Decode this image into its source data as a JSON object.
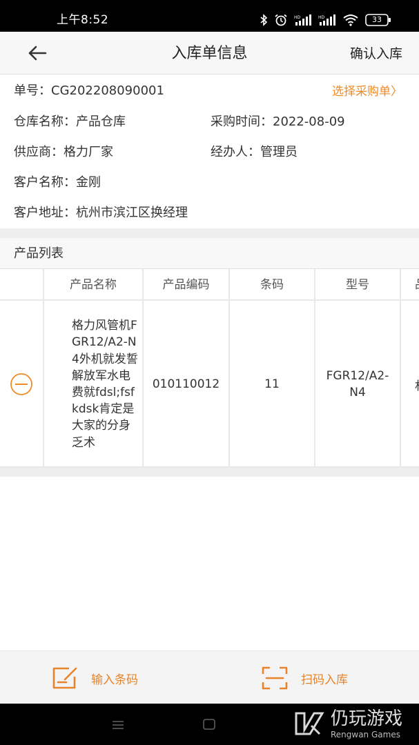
{
  "status_bar": {
    "time": "上午8:52",
    "battery": "33",
    "icons": [
      "bluetooth-icon",
      "alarm-icon",
      "signal-icon",
      "signal-icon",
      "wifi-icon",
      "battery-icon"
    ]
  },
  "header": {
    "title": "入库单信息",
    "confirm_label": "确认入库",
    "back_icon": "arrow-left-icon"
  },
  "order": {
    "number": "单号：CG202208090001",
    "select_po_label": "选择采购单〉",
    "warehouse": "仓库名称：产品仓库",
    "purchase_time": "采购时间：2022-08-09",
    "supplier": "供应商：格力厂家",
    "handler": "经办人：管理员",
    "customer_name": "客户名称：金刚",
    "customer_address": "客户地址：杭州市滨江区换经理"
  },
  "product_list": {
    "title": "产品列表",
    "columns": [
      "",
      "产品名称",
      "产品编码",
      "条码",
      "型号",
      "品"
    ],
    "rows": [
      {
        "name": "格力风管机FGR12/A2-N4外机就发誓解放军水电费就fdsl;fsfkdsk肯定是大家的分身乏术",
        "code": "010110012",
        "barcode": "11",
        "model": "FGR12/A2-N4",
        "extra": "村"
      }
    ]
  },
  "actions": {
    "input_barcode": "输入条码",
    "scan_in": "扫码入库"
  },
  "watermark": {
    "main": "仍玩游戏",
    "sub": "Rengwan Games"
  },
  "colors": {
    "accent": "#f08a24",
    "status_bar": "#000000",
    "header_bg": "#f7f7f7",
    "divider": "#eeeeee"
  }
}
